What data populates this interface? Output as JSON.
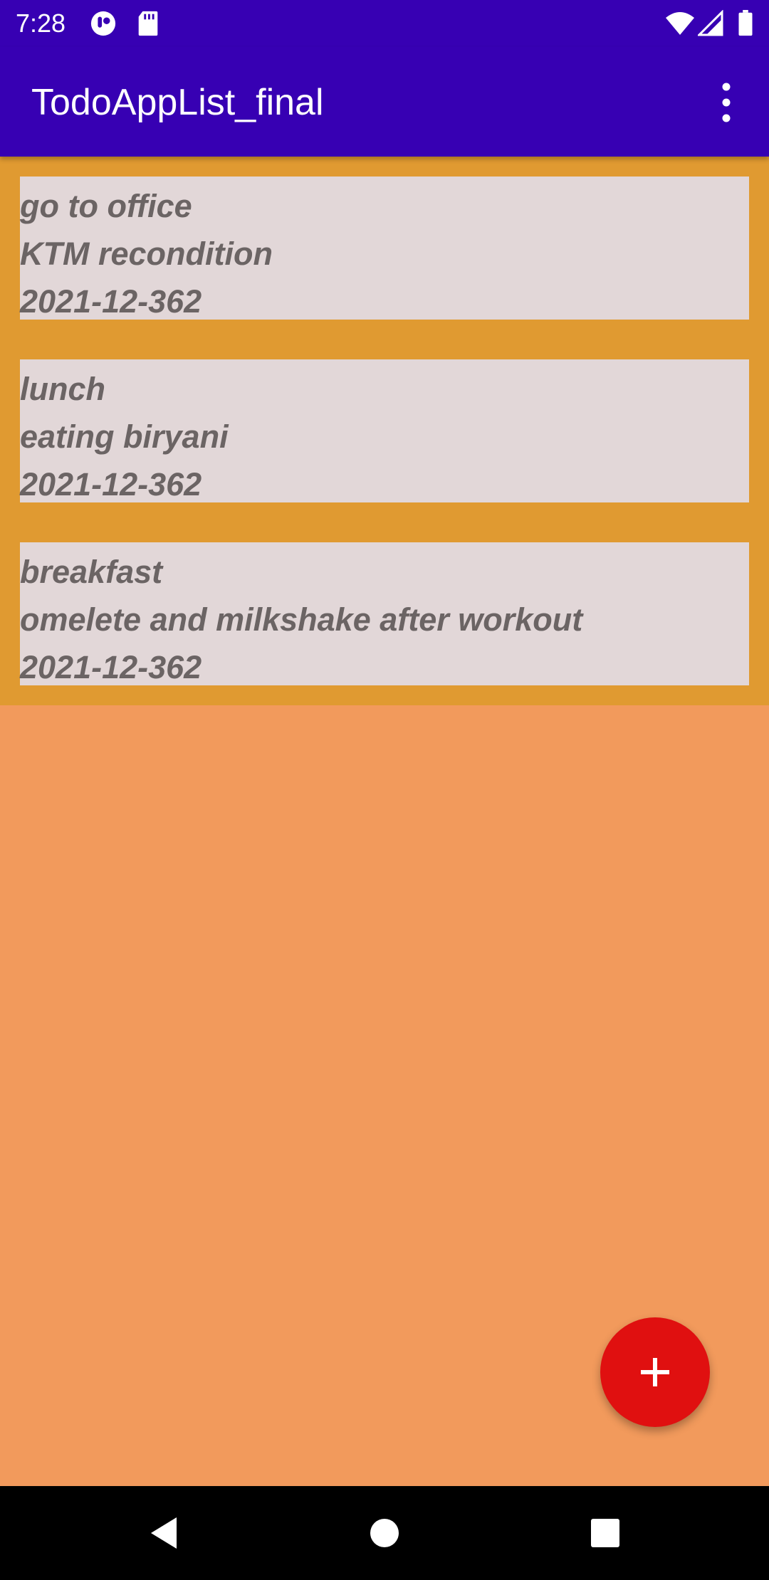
{
  "status_bar": {
    "time": "7:28",
    "icons": [
      "notification-app-icon",
      "sd-card-icon",
      "wifi-icon",
      "signal-icon",
      "battery-icon"
    ]
  },
  "app_bar": {
    "title": "TodoAppList_final",
    "overflow_icon": "more-vert-icon"
  },
  "todos": [
    {
      "title": "go to office",
      "description": "KTM recondition",
      "date": "2021-12-362"
    },
    {
      "title": "lunch",
      "description": "eating biryani",
      "date": "2021-12-362"
    },
    {
      "title": "breakfast",
      "description": "omelete and milkshake after workout",
      "date": "2021-12-362"
    }
  ],
  "fab": {
    "icon": "plus-icon"
  },
  "nav_bar": {
    "icons": [
      "back-icon",
      "home-icon",
      "recents-icon"
    ]
  },
  "colors": {
    "app_bar": "#3700B3",
    "list_background": "#E09A31",
    "screen_background": "#F29A5C",
    "card_background": "#E2D7D8",
    "card_text": "#6B6464",
    "fab": "#E01010"
  }
}
